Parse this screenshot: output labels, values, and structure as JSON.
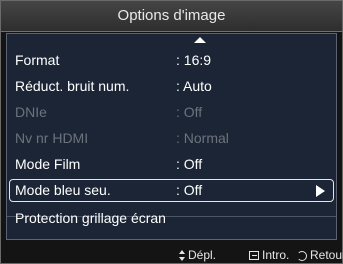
{
  "window": {
    "title": "Options d'image"
  },
  "menu": {
    "items": [
      {
        "label": "Format",
        "value": ": 16:9",
        "disabled": false
      },
      {
        "label": "Réduct. bruit num.",
        "value": ": Auto",
        "disabled": false
      },
      {
        "label": "DNIe",
        "value": ": Off",
        "disabled": true
      },
      {
        "label": "Nv nr HDMI",
        "value": ": Normal",
        "disabled": true
      },
      {
        "label": "Mode Film",
        "value": ": Off",
        "disabled": false
      },
      {
        "label": "Mode bleu seu.",
        "value": ": Off",
        "disabled": false,
        "selected": true
      },
      {
        "label": "Protection grillage écran",
        "value": "",
        "disabled": false
      }
    ]
  },
  "footer": {
    "move_label": "Dépl.",
    "enter_label": "Intro.",
    "return_label": "Retour"
  },
  "icons": {
    "scroll_up": "up-triangle-icon",
    "submenu": "right-triangle-icon",
    "move": "up-down-icon",
    "enter": "enter-icon",
    "return": "return-icon"
  },
  "colors": {
    "background": "#141414",
    "content_panel": "#1b2535",
    "text": "#ffffff",
    "disabled_text": "#6d737c",
    "selection_border": "#e6e6e6"
  }
}
